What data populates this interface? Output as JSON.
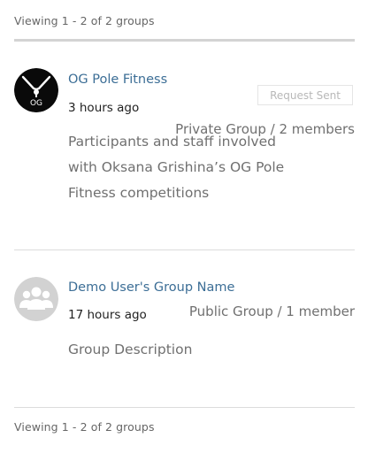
{
  "pagination": {
    "top": "Viewing 1 - 2 of 2 groups",
    "bottom": "Viewing 1 - 2 of 2 groups"
  },
  "groups": [
    {
      "name": "OG Pole Fitness",
      "time": "3 hours ago",
      "meta": "Private Group / 2 members",
      "description": "Participants and staff involved with Oksana Grishina’s OG Pole Fitness competitions",
      "action_label": "Request Sent",
      "avatar_text": "OG",
      "avatar_icon": "pole-fitness-logo-icon"
    },
    {
      "name": "Demo User's Group Name",
      "time": "17 hours ago",
      "meta": "Public Group / 1 member",
      "description": "Group Description",
      "avatar_icon": "group-placeholder-icon"
    }
  ],
  "colors": {
    "link": "#3c6e96",
    "muted": "#707070",
    "divider": "#dcdcdc"
  }
}
